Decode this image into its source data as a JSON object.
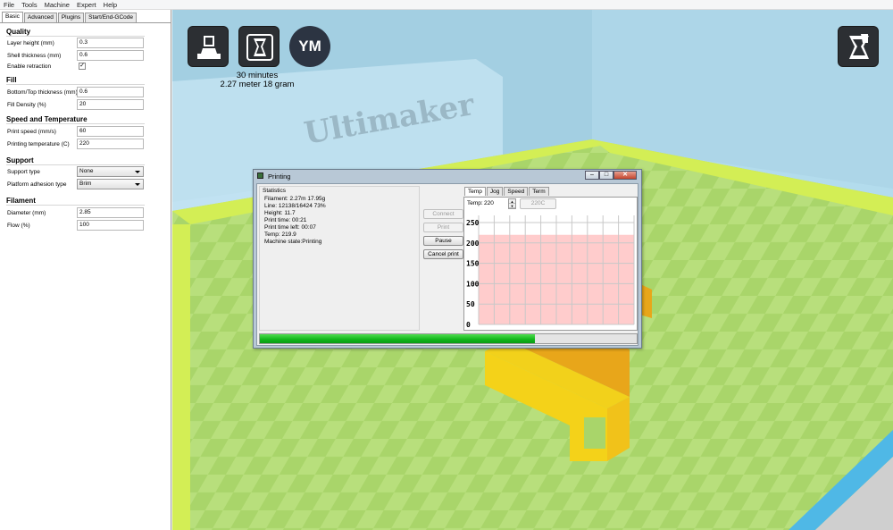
{
  "menu": [
    "File",
    "Tools",
    "Machine",
    "Expert",
    "Help"
  ],
  "left_tabs": [
    "Basic",
    "Advanced",
    "Plugins",
    "Start/End-GCode"
  ],
  "quality": {
    "title": "Quality",
    "layer_height_label": "Layer height (mm)",
    "layer_height": "0.3",
    "shell_thickness_label": "Shell thickness (mm)",
    "shell_thickness": "0.6",
    "retraction_label": "Enable retraction",
    "retraction_mark": "✓"
  },
  "fill": {
    "title": "Fill",
    "bottom_top_label": "Bottom/Top thickness (mm)",
    "bottom_top": "0.6",
    "density_label": "Fill Density (%)",
    "density": "20"
  },
  "speed_temp": {
    "title": "Speed and Temperature",
    "print_speed_label": "Print speed (mm/s)",
    "print_speed": "60",
    "print_temp_label": "Printing temperature (C)",
    "print_temp": "220"
  },
  "support": {
    "title": "Support",
    "support_type_label": "Support type",
    "support_type": "None",
    "adhesion_label": "Platform adhesion type",
    "adhesion": "Brim"
  },
  "filament": {
    "title": "Filament",
    "diameter_label": "Diameter (mm)",
    "diameter": "2.85",
    "flow_label": "Flow (%)",
    "flow": "100"
  },
  "toolbar": {
    "icons": [
      "load-model-icon",
      "print-icon",
      "youmagine-icon",
      "view-mode-icon"
    ],
    "ym_text": "YM"
  },
  "print_info": {
    "time": "30 minutes",
    "material": "2.27 meter 18 gram"
  },
  "dialog": {
    "title": "Printing",
    "stats_title": "Statistics",
    "stats": [
      "Filament: 2.27m 17.95g",
      "Line: 12138/16424 73%",
      "Height: 11.7",
      "Print time: 00:21",
      "Print time left: 00:07",
      "Temp: 219.9",
      "Machine state:Printing"
    ],
    "buttons": {
      "connect": "Connect",
      "print": "Print",
      "pause": "Pause",
      "cancel": "Cancel print"
    },
    "tabs": [
      "Temp",
      "Jog",
      "Speed",
      "Term"
    ],
    "temp_label": "Temp:",
    "temp_value": "220",
    "temp_button": "220C",
    "progress": 0.73,
    "graph_labels": [
      "250",
      "200",
      "150",
      "100",
      "50",
      "0"
    ],
    "graph_fill_level": 219.9,
    "graph_max": 250,
    "colors": {
      "progress": "#12b51c",
      "graph_fill": "#ffcccc"
    }
  },
  "watermark_text": "Ultimaker"
}
